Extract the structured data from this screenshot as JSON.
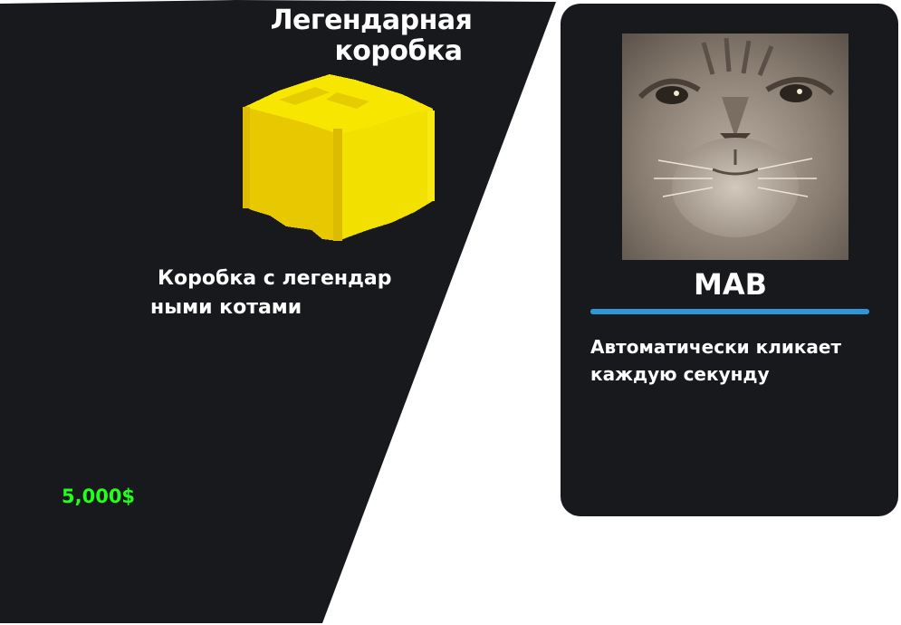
{
  "shop_item": {
    "title_line1": "Легендарная",
    "title_line2": "коробка",
    "description_line1": "Коробка с легендар",
    "description_line2": "ными котами",
    "price": "5,000$",
    "icon": "yellow-box-icon",
    "colors": {
      "card_bg": "#18191c",
      "price": "#22ff1e",
      "box_light": "#f5e300",
      "box_dark": "#e4c400"
    }
  },
  "upgrade": {
    "name": "MAB",
    "description_line1": "Автоматически кликает",
    "description_line2": "каждую секунду",
    "icon": "cat-portrait",
    "progress": 1.0,
    "colors": {
      "card_bg": "#18191c",
      "progress": "#2b97d8"
    }
  }
}
